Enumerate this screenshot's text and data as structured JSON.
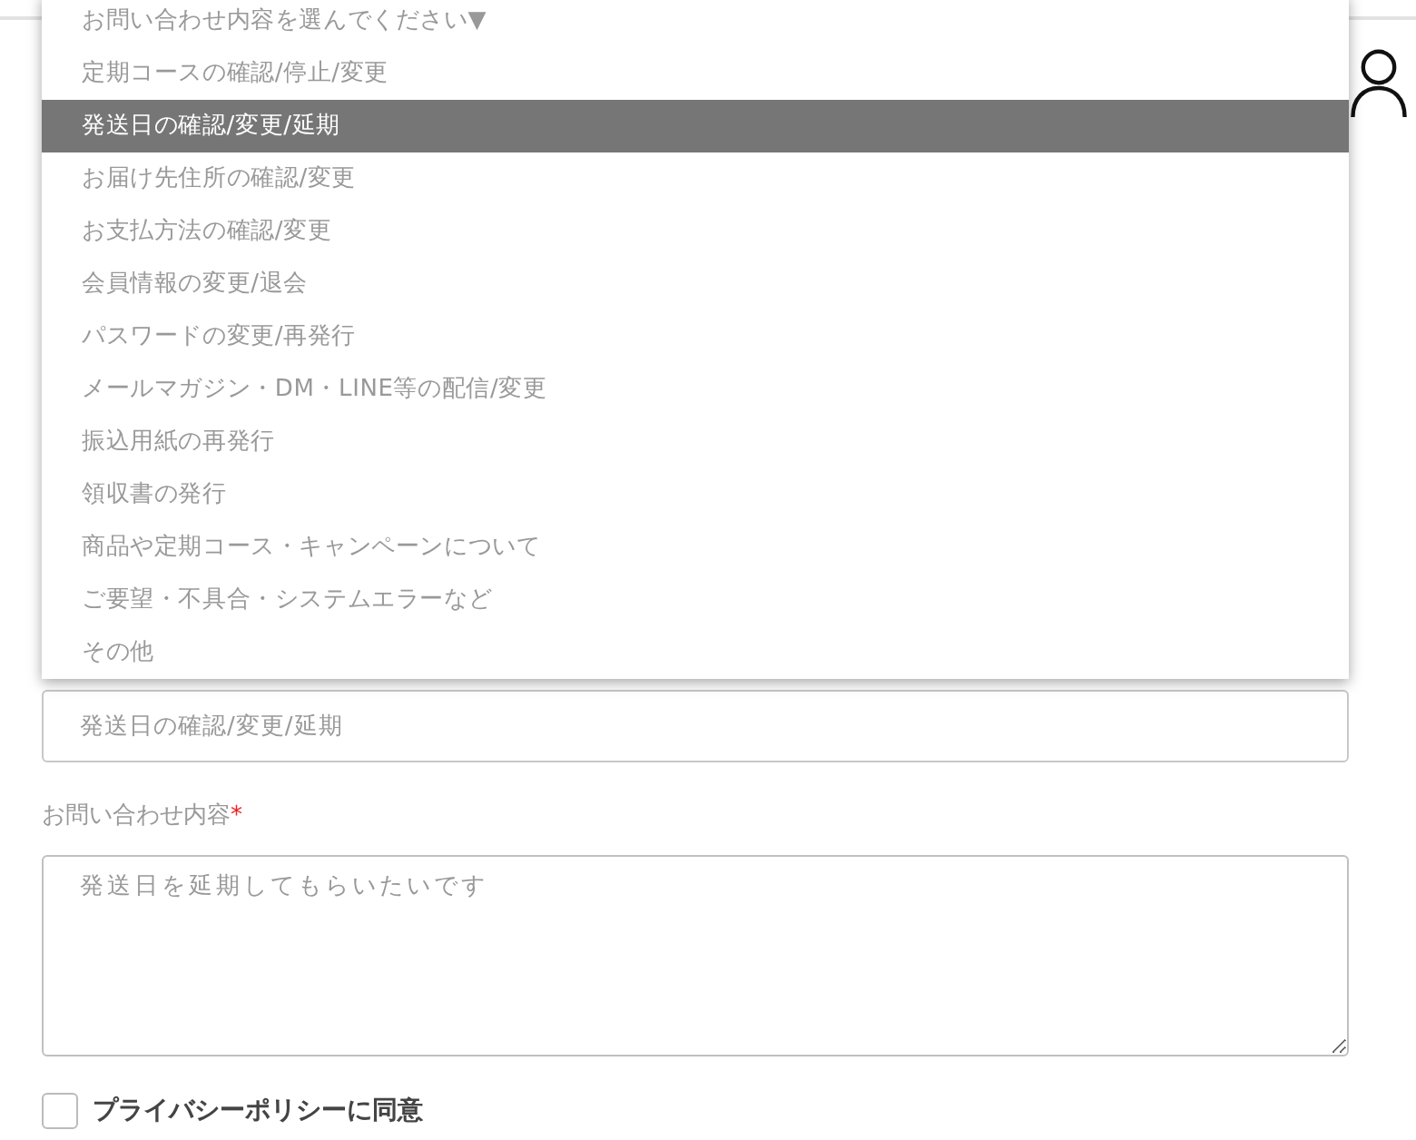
{
  "dropdown": {
    "options": [
      {
        "label": "お問い合わせ内容を選んでください▼",
        "selected": false
      },
      {
        "label": "定期コースの確認/停止/変更",
        "selected": false
      },
      {
        "label": "発送日の確認/変更/延期",
        "selected": true
      },
      {
        "label": "お届け先住所の確認/変更",
        "selected": false
      },
      {
        "label": "お支払方法の確認/変更",
        "selected": false
      },
      {
        "label": "会員情報の変更/退会",
        "selected": false
      },
      {
        "label": "パスワードの変更/再発行",
        "selected": false
      },
      {
        "label": "メールマガジン・DM・LINE等の配信/変更",
        "selected": false
      },
      {
        "label": "振込用紙の再発行",
        "selected": false
      },
      {
        "label": "領収書の発行",
        "selected": false
      },
      {
        "label": "商品や定期コース・キャンペーンについて",
        "selected": false
      },
      {
        "label": "ご要望・不具合・システムエラーなど",
        "selected": false
      },
      {
        "label": "その他",
        "selected": false
      }
    ]
  },
  "inquiry_type_field": {
    "value": "発送日の確認/変更/延期"
  },
  "message": {
    "label": "お問い合わせ内容",
    "required_mark": "*",
    "value": "発送日を延期してもらいたいです"
  },
  "privacy": {
    "label": "プライバシーポリシーに同意",
    "checked": false
  }
}
